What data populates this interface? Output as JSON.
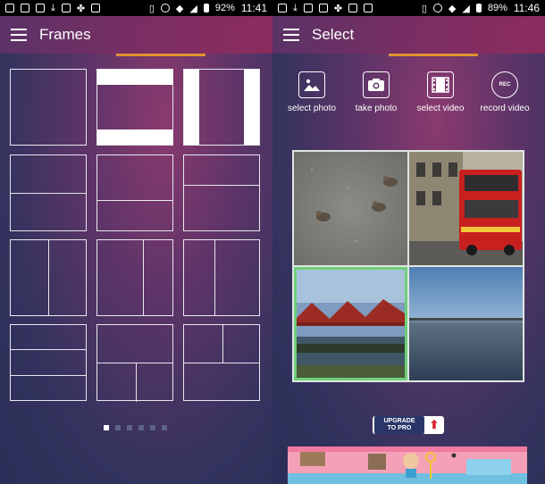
{
  "left": {
    "status": {
      "battery": "92%",
      "time": "11:41"
    },
    "title": "Frames",
    "page_indicator": {
      "count": 6,
      "active_index": 0
    }
  },
  "right": {
    "status": {
      "battery": "89%",
      "time": "11:46"
    },
    "title": "Select",
    "actions": [
      {
        "label": "select photo",
        "icon": "image-icon"
      },
      {
        "label": "take photo",
        "icon": "camera-icon"
      },
      {
        "label": "select video",
        "icon": "film-icon"
      },
      {
        "label": "record video",
        "icon": "rec-icon",
        "icon_text": "REC"
      }
    ],
    "photos": [
      {
        "subject": "birds-on-pavement",
        "selected": false
      },
      {
        "subject": "red-double-decker-bus",
        "selected": false
      },
      {
        "subject": "red-rail-bridge",
        "selected": true
      },
      {
        "subject": "water-horizon",
        "selected": false
      }
    ],
    "upgrade": {
      "line1": "UPGRADE",
      "line2": "TO PRO"
    }
  },
  "colors": {
    "accent": "#e0922f",
    "selection": "#6fcf7a",
    "upgrade_red": "#d6262c"
  }
}
